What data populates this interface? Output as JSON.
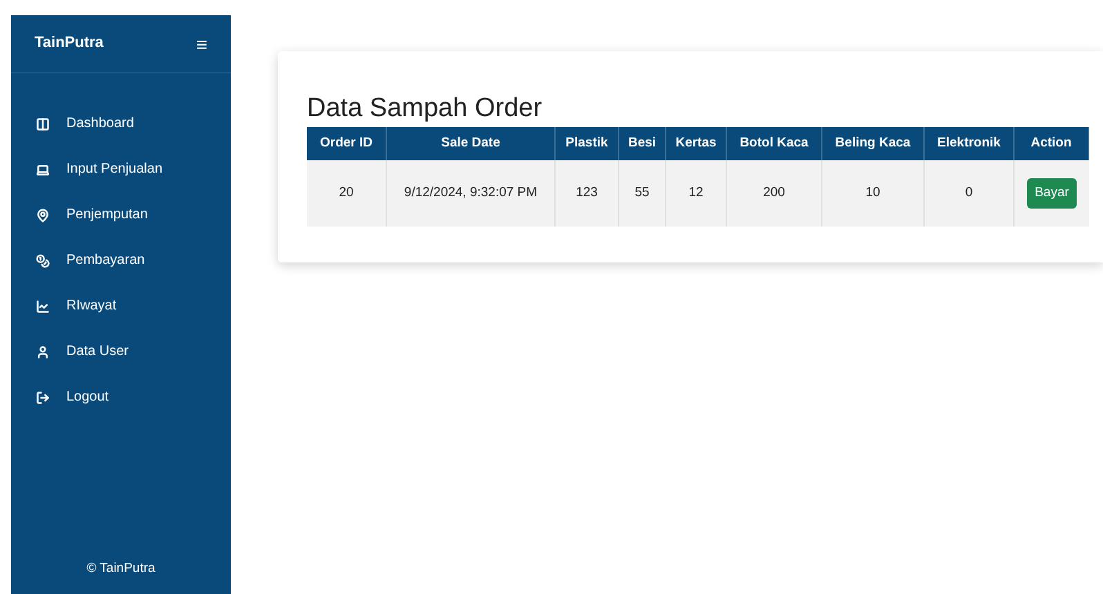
{
  "sidebar": {
    "brand": "TainPutra",
    "menu_icon": "≡",
    "items": [
      "Dashboard",
      "Input Penjualan",
      "Penjemputan",
      "Pembayaran",
      "RIwayat",
      "Data User",
      "Logout"
    ],
    "footer": "© TainPutra"
  },
  "main": {
    "title": "Data Sampah Order",
    "table": {
      "columns": [
        "Order ID",
        "Sale Date",
        "Plastik",
        "Besi",
        "Kertas",
        "Botol Kaca",
        "Beling Kaca",
        "Elektronik",
        "Action"
      ],
      "rows": [
        {
          "cells": [
            "20",
            "9/12/2024, 9:32:07 PM",
            "123",
            "55",
            "12",
            "200",
            "10",
            "0"
          ],
          "action": "Bayar"
        }
      ]
    }
  }
}
